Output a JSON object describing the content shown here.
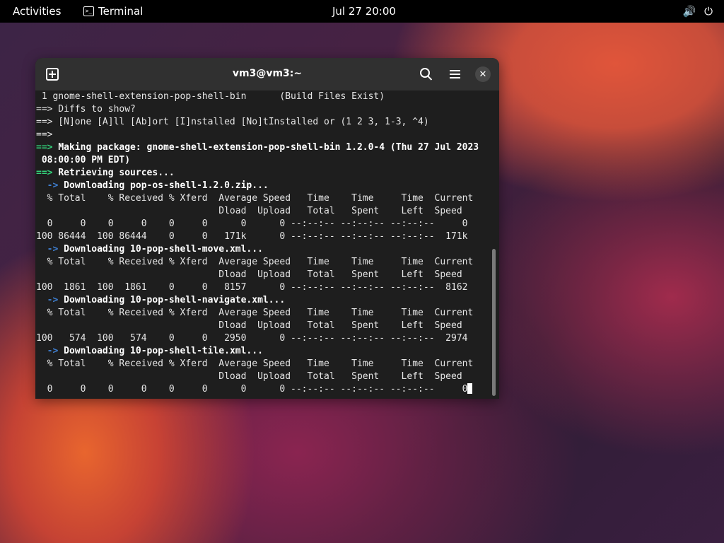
{
  "topbar": {
    "activities": "Activities",
    "app_name": "Terminal",
    "clock": "Jul 27  20:00",
    "volume_icon": "🔊",
    "power_icon": "⏻"
  },
  "window": {
    "title": "vm3@vm3:~",
    "close_glyph": "✕"
  },
  "terminal": {
    "lines": [
      {
        "text": " 1 gnome-shell-extension-pop-shell-bin      (Build Files Exist)"
      },
      {
        "text": "==> Diffs to show?"
      },
      {
        "text": "==> [N]one [A]ll [Ab]ort [I]nstalled [No]tInstalled or (1 2 3, 1-3, ^4)"
      },
      {
        "text": "==>"
      },
      {
        "prefix": "==> ",
        "prefix_style": "g",
        "text": "Making package: gnome-shell-extension-pop-shell-bin 1.2.0-4 (Thu 27 Jul 2023",
        "style": "bold"
      },
      {
        "text": " 08:00:00 PM EDT)",
        "style": "bold"
      },
      {
        "prefix": "==> ",
        "prefix_style": "g",
        "text": "Retrieving sources...",
        "style": "bold"
      },
      {
        "prefix": "  -> ",
        "prefix_style": "b",
        "text": "Downloading pop-os-shell-1.2.0.zip...",
        "style": "bold"
      },
      {
        "text": "  % Total    % Received % Xferd  Average Speed   Time    Time     Time  Current"
      },
      {
        "text": "                                 Dload  Upload   Total   Spent    Left  Speed"
      },
      {
        "text": "  0     0    0     0    0     0      0      0 --:--:-- --:--:-- --:--:--     0"
      },
      {
        "text": "100 86444  100 86444    0     0   171k      0 --:--:-- --:--:-- --:--:--  171k"
      },
      {
        "prefix": "  -> ",
        "prefix_style": "b",
        "text": "Downloading 10-pop-shell-move.xml...",
        "style": "bold"
      },
      {
        "text": "  % Total    % Received % Xferd  Average Speed   Time    Time     Time  Current"
      },
      {
        "text": "                                 Dload  Upload   Total   Spent    Left  Speed"
      },
      {
        "text": "100  1861  100  1861    0     0   8157      0 --:--:-- --:--:-- --:--:--  8162"
      },
      {
        "prefix": "  -> ",
        "prefix_style": "b",
        "text": "Downloading 10-pop-shell-navigate.xml...",
        "style": "bold"
      },
      {
        "text": "  % Total    % Received % Xferd  Average Speed   Time    Time     Time  Current"
      },
      {
        "text": "                                 Dload  Upload   Total   Spent    Left  Speed"
      },
      {
        "text": "100   574  100   574    0     0   2950      0 --:--:-- --:--:-- --:--:--  2974"
      },
      {
        "prefix": "  -> ",
        "prefix_style": "b",
        "text": "Downloading 10-pop-shell-tile.xml...",
        "style": "bold"
      },
      {
        "text": "  % Total    % Received % Xferd  Average Speed   Time    Time     Time  Current"
      },
      {
        "text": "                                 Dload  Upload   Total   Spent    Left  Speed"
      },
      {
        "text": "  0     0    0     0    0     0      0      0 --:--:-- --:--:-- --:--:--     0",
        "cursor": true
      }
    ]
  }
}
